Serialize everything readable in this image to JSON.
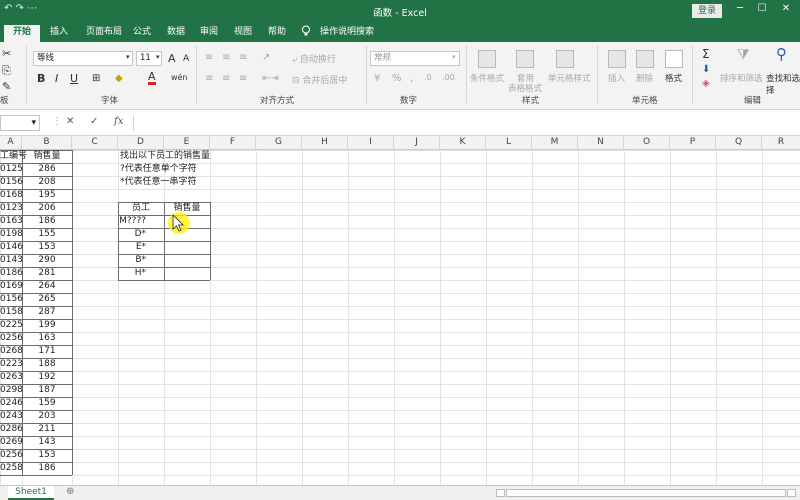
{
  "window": {
    "title": "函数 - Excel",
    "login": "登录",
    "quick_access": "↶ ↷ ⋯",
    "min": "─",
    "max": "☐",
    "close": "✕"
  },
  "tabs": [
    "开始",
    "插入",
    "页面布局",
    "公式",
    "数据",
    "审阅",
    "视图",
    "帮助",
    "操作说明搜索"
  ],
  "ribbon": {
    "font_name": "等线",
    "font_size": "11",
    "bold": "B",
    "italic": "I",
    "underline": "U",
    "grow_font": "A",
    "shrink_font": "A",
    "font_color": "A",
    "wrap_text": "自动换行",
    "merge_center": "合并后居中",
    "number_format": "常规",
    "cond_format": "条件格式",
    "table_format_1": "套用",
    "table_format_2": "表格格式",
    "cell_styles": "单元格样式",
    "insert": "插入",
    "delete": "删除",
    "format": "格式",
    "sum": "Σ",
    "sort_filter": "排序和筛选",
    "find_select": "查找和选择",
    "groups": [
      "字体",
      "对齐方式",
      "数字",
      "样式",
      "单元格",
      "编辑"
    ],
    "clipboard_tail": "板"
  },
  "formula_bar": {
    "name_box": "",
    "cancel": "✕",
    "enter": "✓",
    "fx": "fx"
  },
  "columns": [
    "A",
    "B",
    "C",
    "D",
    "E",
    "F",
    "G",
    "H",
    "I",
    "J",
    "K",
    "L",
    "M",
    "N",
    "O",
    "P",
    "Q",
    "R"
  ],
  "sheet": {
    "headers": [
      "工编号",
      "销售量"
    ],
    "rows": [
      [
        "0125",
        "286"
      ],
      [
        "0156",
        "208"
      ],
      [
        "0168",
        "195"
      ],
      [
        "0123",
        "206"
      ],
      [
        "0163",
        "186"
      ],
      [
        "0198",
        "155"
      ],
      [
        "0146",
        "153"
      ],
      [
        "0143",
        "290"
      ],
      [
        "0186",
        "281"
      ],
      [
        "0169",
        "264"
      ],
      [
        "0156",
        "265"
      ],
      [
        "0158",
        "287"
      ],
      [
        "0225",
        "199"
      ],
      [
        "0256",
        "163"
      ],
      [
        "0268",
        "171"
      ],
      [
        "0223",
        "188"
      ],
      [
        "0263",
        "192"
      ],
      [
        "0298",
        "187"
      ],
      [
        "0246",
        "159"
      ],
      [
        "0243",
        "203"
      ],
      [
        "0286",
        "211"
      ],
      [
        "0269",
        "143"
      ],
      [
        "0256",
        "153"
      ],
      [
        "0258",
        "186"
      ]
    ],
    "notes": [
      "找出以下员工的销售量",
      "?代表任意单个字符",
      "*代表任意一串字符"
    ],
    "lookup_headers": [
      "员工",
      "销售量"
    ],
    "lookup_rows": [
      "M????",
      "D*",
      "E*",
      "B*",
      "H*"
    ]
  },
  "statusbar": {
    "sheet_tab": "Sheet1",
    "add_sheet": "⊕"
  },
  "colors": {
    "accent": "#217346",
    "highlight": "#fff200"
  }
}
